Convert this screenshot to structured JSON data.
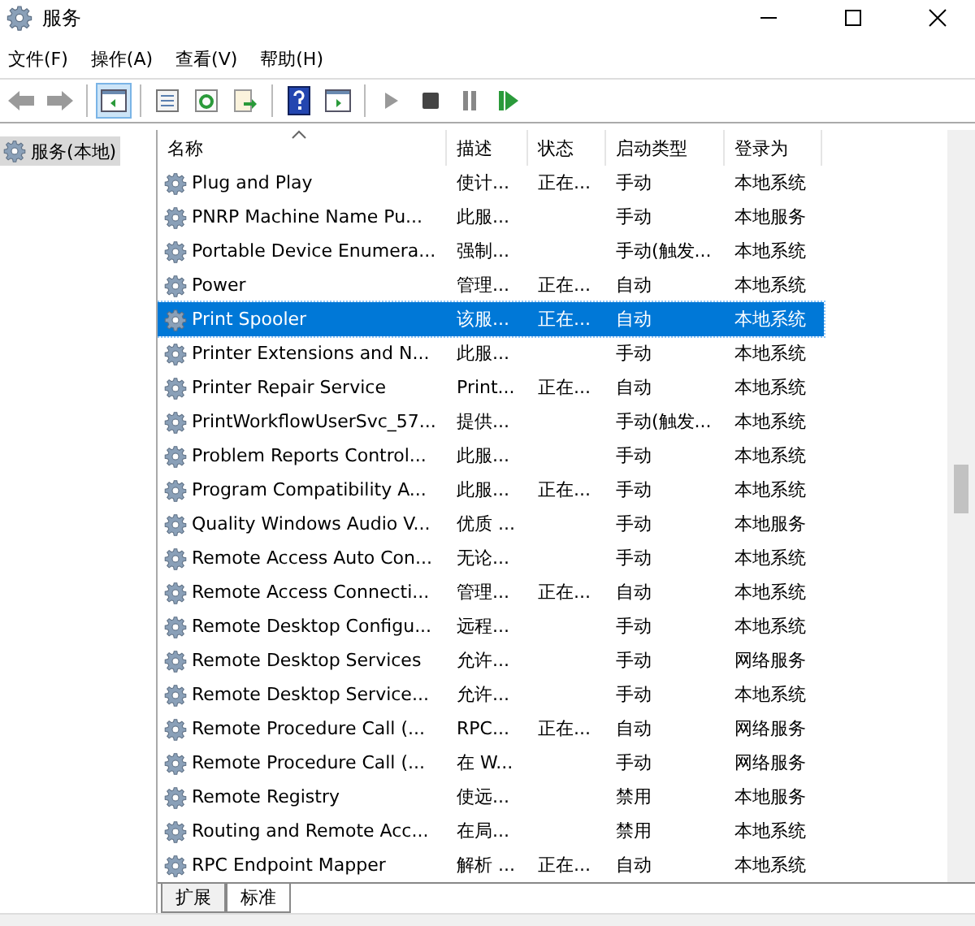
{
  "window": {
    "title": "服务"
  },
  "menu": [
    "文件(F)",
    "操作(A)",
    "查看(V)",
    "帮助(H)"
  ],
  "toolbar": [
    [
      {
        "kind": "back",
        "selected": false
      },
      {
        "kind": "forward",
        "selected": false
      }
    ],
    [
      {
        "kind": "tree",
        "selected": true
      }
    ],
    [
      {
        "kind": "properties",
        "selected": false
      },
      {
        "kind": "refresh",
        "selected": false
      },
      {
        "kind": "export",
        "selected": false
      }
    ],
    [
      {
        "kind": "help",
        "selected": false
      },
      {
        "kind": "view",
        "selected": false
      }
    ],
    [
      {
        "kind": "play",
        "selected": false
      },
      {
        "kind": "stop",
        "selected": false
      },
      {
        "kind": "pause",
        "selected": false
      },
      {
        "kind": "resume",
        "selected": false
      }
    ]
  ],
  "tree": [
    {
      "label": "服务(本地)",
      "selected": true
    }
  ],
  "table": {
    "columns": [
      {
        "label": "名称",
        "sorted": true
      },
      {
        "label": "描述",
        "sorted": false
      },
      {
        "label": "状态",
        "sorted": false
      },
      {
        "label": "启动类型",
        "sorted": false
      },
      {
        "label": "登录为",
        "sorted": false
      }
    ],
    "rows": [
      {
        "cells": [
          "Plug and Play",
          "使计...",
          "正在...",
          "手动",
          "本地系统"
        ],
        "selected": false
      },
      {
        "cells": [
          "PNRP Machine Name Pu...",
          "此服...",
          "",
          "手动",
          "本地服务"
        ],
        "selected": false
      },
      {
        "cells": [
          "Portable Device Enumera...",
          "强制...",
          "",
          "手动(触发...",
          "本地系统"
        ],
        "selected": false
      },
      {
        "cells": [
          "Power",
          "管理...",
          "正在...",
          "自动",
          "本地系统"
        ],
        "selected": false
      },
      {
        "cells": [
          "Print Spooler",
          "该服...",
          "正在...",
          "自动",
          "本地系统"
        ],
        "selected": true
      },
      {
        "cells": [
          "Printer Extensions and N...",
          "此服...",
          "",
          "手动",
          "本地系统"
        ],
        "selected": false
      },
      {
        "cells": [
          "Printer Repair Service",
          "Print...",
          "正在...",
          "自动",
          "本地系统"
        ],
        "selected": false
      },
      {
        "cells": [
          "PrintWorkflowUserSvc_57...",
          "提供...",
          "",
          "手动(触发...",
          "本地系统"
        ],
        "selected": false
      },
      {
        "cells": [
          "Problem Reports Control...",
          "此服...",
          "",
          "手动",
          "本地系统"
        ],
        "selected": false
      },
      {
        "cells": [
          "Program Compatibility A...",
          "此服...",
          "正在...",
          "手动",
          "本地系统"
        ],
        "selected": false
      },
      {
        "cells": [
          "Quality Windows Audio V...",
          "优质 ...",
          "",
          "手动",
          "本地服务"
        ],
        "selected": false
      },
      {
        "cells": [
          "Remote Access Auto Con...",
          "无论...",
          "",
          "手动",
          "本地系统"
        ],
        "selected": false
      },
      {
        "cells": [
          "Remote Access Connecti...",
          "管理...",
          "正在...",
          "自动",
          "本地系统"
        ],
        "selected": false
      },
      {
        "cells": [
          "Remote Desktop Configu...",
          "远程...",
          "",
          "手动",
          "本地系统"
        ],
        "selected": false
      },
      {
        "cells": [
          "Remote Desktop Services",
          "允许...",
          "",
          "手动",
          "网络服务"
        ],
        "selected": false
      },
      {
        "cells": [
          "Remote Desktop Service...",
          "允许...",
          "",
          "手动",
          "本地系统"
        ],
        "selected": false
      },
      {
        "cells": [
          "Remote Procedure Call (...",
          "RPC...",
          "正在...",
          "自动",
          "网络服务"
        ],
        "selected": false
      },
      {
        "cells": [
          "Remote Procedure Call (...",
          "在 W...",
          "",
          "手动",
          "网络服务"
        ],
        "selected": false
      },
      {
        "cells": [
          "Remote Registry",
          "使远...",
          "",
          "禁用",
          "本地服务"
        ],
        "selected": false
      },
      {
        "cells": [
          "Routing and Remote Acc...",
          "在局...",
          "",
          "禁用",
          "本地系统"
        ],
        "selected": false
      },
      {
        "cells": [
          "RPC Endpoint Mapper",
          "解析 ...",
          "正在...",
          "自动",
          "本地系统"
        ],
        "selected": false
      }
    ]
  },
  "tabs": [
    {
      "label": "扩展",
      "selected": false
    },
    {
      "label": "标准",
      "selected": true
    }
  ]
}
